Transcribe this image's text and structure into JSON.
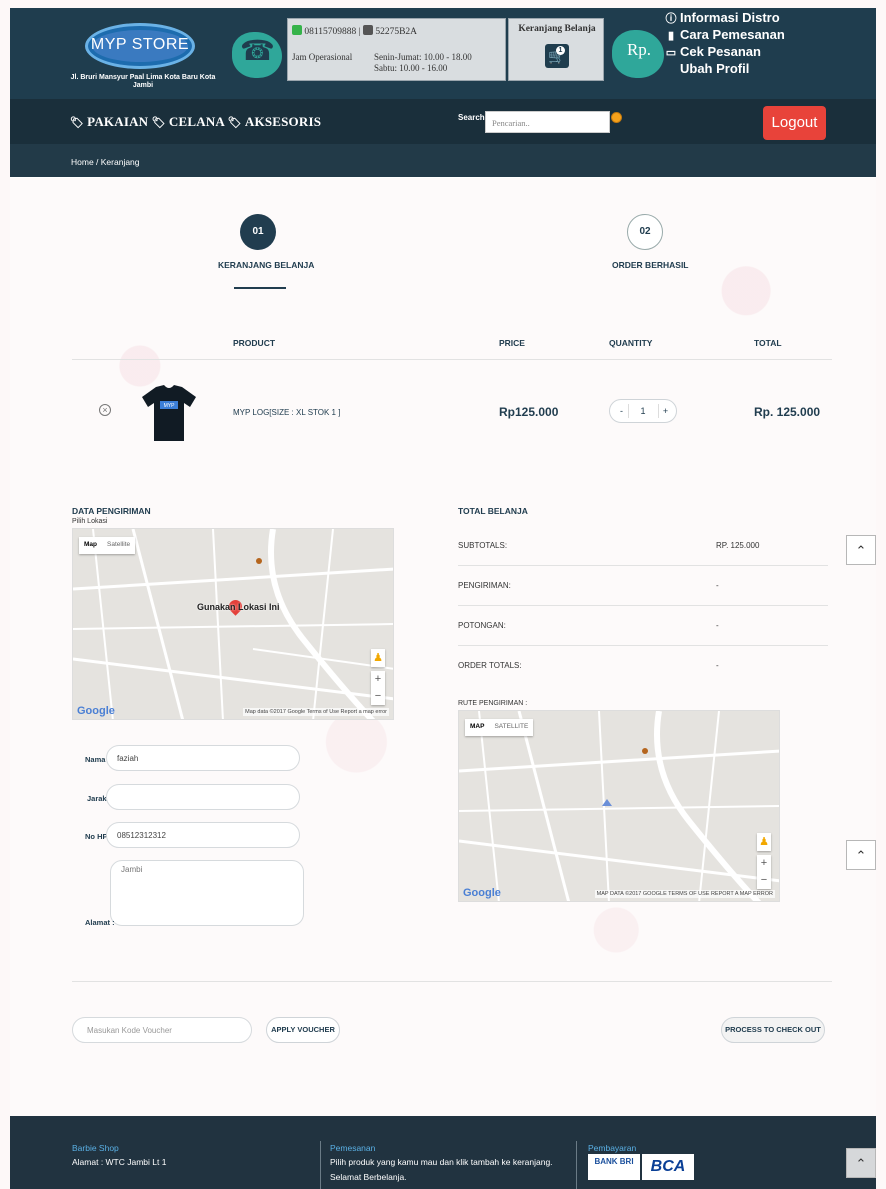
{
  "header": {
    "logo": "MYP STORE",
    "address": "Jl. Bruri Mansyur Paal Lima Kota Baru Kota Jambi",
    "phone": "08115709888",
    "bbm": "52275B2A",
    "jam_label": "Jam Operasional",
    "jam_weekday": "Senin-Jumat: 10.00 - 18.00",
    "jam_saturday": "Sabtu: 10.00 - 16.00",
    "cart_title": "Keranjang Belanja",
    "cart_count": "1",
    "rp": "Rp.",
    "menu": [
      "Informasi Distro",
      "Cara Pemesanan",
      "Cek Pesanan",
      "Ubah Profil"
    ]
  },
  "nav": {
    "links": [
      "PAKAIAN",
      "CELANA",
      "AKSESORIS"
    ],
    "search_label": "Search",
    "search_placeholder": "Pencarian..",
    "logout": "Logout"
  },
  "breadcrumb": "Home  /  Keranjang",
  "steps": [
    {
      "num": "01",
      "label": "KERANJANG BELANJA"
    },
    {
      "num": "02",
      "label": "ORDER BERHASIL"
    }
  ],
  "table": {
    "headers": [
      "PRODUCT",
      "PRICE",
      "QUANTITY",
      "TOTAL"
    ],
    "row": {
      "name": "MYP LOG[SIZE : XL STOK 1 ]",
      "price": "Rp125.000",
      "qty": "1",
      "total": "Rp. 125.000"
    }
  },
  "shipping": {
    "title": "DATA PENGIRIMAN",
    "subtitle": "Pilih Lokasi",
    "map1": {
      "tab_map": "Map",
      "tab_sat": "Satellite",
      "marker_label": "Gunakan Lokasi Ini",
      "footer": "Map data ©2017 Google   Terms of Use   Report a map error"
    },
    "fields": {
      "nama_label": "Nama :",
      "nama_value": "faziah",
      "jarak_label": "Jarak :",
      "jarak_value": "",
      "nohp_label": "No HP :",
      "nohp_value": "08512312312",
      "alamat_label": "Alamat :",
      "alamat_value": "Jambi"
    }
  },
  "totals": {
    "title": "TOTAL BELANJA",
    "subtotal_label": "SUBTOTALS:",
    "subtotal_value": "RP. 125.000",
    "shipping_label": "PENGIRIMAN:",
    "shipping_value": "-",
    "discount_label": "POTONGAN:",
    "discount_value": "-",
    "order_label": "ORDER TOTALS:",
    "order_value": "-",
    "route_label": "RUTE PENGIRIMAN :",
    "map2": {
      "tab_map": "MAP",
      "tab_sat": "SATELLITE",
      "footer": "MAP DATA ©2017 GOOGLE   TERMS OF USE   REPORT A MAP ERROR"
    }
  },
  "voucher": {
    "placeholder": "Masukan Kode Voucher",
    "apply": "APPLY VOUCHER",
    "checkout": "PROCESS TO CHECK OUT"
  },
  "footer": {
    "col1_title": "Barbie Shop",
    "col1_text": "Alamat : WTC Jambi Lt 1",
    "col2_title": "Pemesanan",
    "col2_text": "Pilih produk yang kamu mau dan klik tambah ke keranjang. Selamat Berbelanja.",
    "col3_title": "Pembayaran",
    "bank1": "BANK BRI",
    "bank2": "BCA"
  },
  "colors": {
    "primary": "#1f3d4e",
    "logout": "#e8433a",
    "accent_blob": "#2fa79a"
  },
  "icons": [
    "phone-icon",
    "whatsapp-icon",
    "bbm-icon",
    "cart-icon",
    "info-icon",
    "bookmark-icon",
    "laptop-icon",
    "tag-icon",
    "remove-icon",
    "chevron-up-icon"
  ]
}
